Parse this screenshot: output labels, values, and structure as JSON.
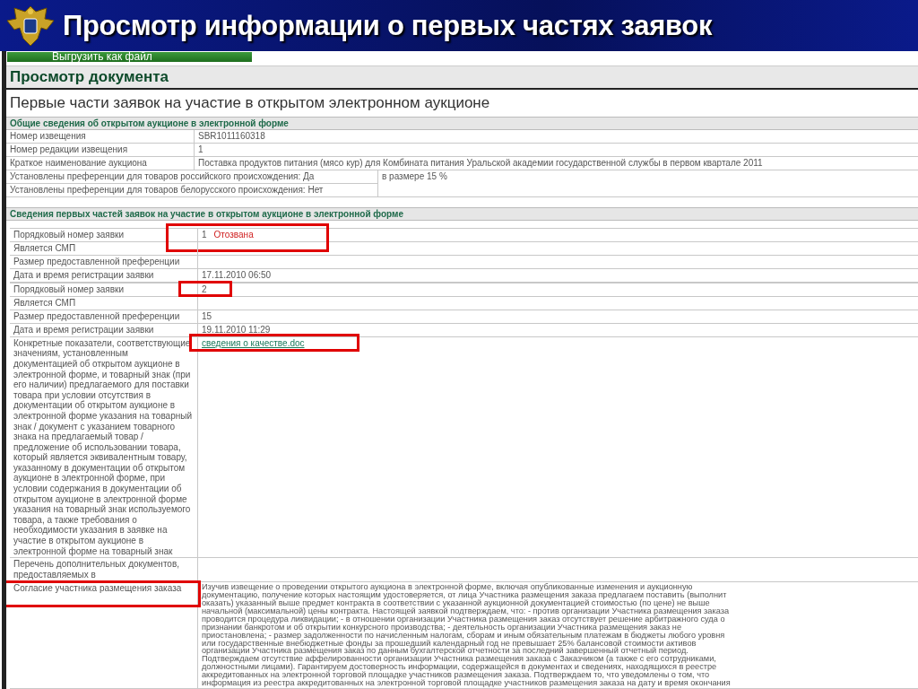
{
  "slide_title": "Просмотр информации о первых частях заявок",
  "export_button": "Выгрузить как файл",
  "page_heading": "Просмотр документа",
  "document_title": "Первые части заявок на участие в открытом электронном аукционе",
  "general_section": {
    "heading": "Общие сведения об открытом аукционе в электронной форме",
    "rows": [
      {
        "label": "Номер извещения",
        "value": "SBR1011160318"
      },
      {
        "label": "Номер редакции извещения",
        "value": "1"
      },
      {
        "label": "Краткое наименование аукциона",
        "value": "Поставка продуктов питания (мясо кур) для Комбината питания Уральской академии государственной службы в первом квартале 2011"
      }
    ],
    "preferences": [
      "Установлены преференции для товаров российского происхождения: Да",
      "Установлены преференции для товаров белорусского происхождения: Нет"
    ],
    "preference_value": "в размере 15 %"
  },
  "applications_section": {
    "heading": "Сведения первых частей заявок на участие в открытом аукционе в электронной форме",
    "rows": [
      {
        "label": "Порядковый номер заявки",
        "kind": "text",
        "value": "1",
        "status": "Отозвана",
        "highlighted": true,
        "group_start": true
      },
      {
        "label": "Является СМП",
        "kind": "text",
        "value": "",
        "highlighted": false,
        "group_start": false
      },
      {
        "label": "Размер предоставленной преференции",
        "kind": "text",
        "value": "",
        "highlighted": false,
        "group_start": false
      },
      {
        "label": "Дата и время регистрации заявки",
        "kind": "text",
        "value": "17.11.2010 06:50",
        "highlighted": false,
        "group_start": false
      },
      {
        "label": "Порядковый номер заявки",
        "kind": "text",
        "value": "2",
        "highlighted": true,
        "group_start": true
      },
      {
        "label": "Является СМП",
        "kind": "text",
        "value": "",
        "highlighted": false,
        "group_start": false
      },
      {
        "label": "Размер предоставленной преференции",
        "kind": "text",
        "value": "15",
        "highlighted": false,
        "group_start": false
      },
      {
        "label": "Дата и время регистрации заявки",
        "kind": "text",
        "value": "19.11.2010 11:29",
        "highlighted": false,
        "group_start": false
      },
      {
        "label": "Конкретные показатели, соответствующие значениям, установленным документацией об открытом аукционе в электронной форме, и товарный знак (при его наличии) предлагаемого для поставки товара при условии отсутствия в документации об открытом аукционе в электронной форме указания на товарный знак / документ с указанием товарного знака на предлагаемый товар / предложение об использовании товара, который является эквивалентным товару, указанному в документации об открытом аукционе в электронной форме, при условии содержания в документации об открытом аукционе в электронной форме указания на товарный знак используемого товара, а также требования о необходимости указания в заявке на участие в открытом аукционе в электронной форме на товарный знак",
        "kind": "link",
        "value": "сведения о качестве.doc",
        "highlighted": true,
        "group_start": false
      },
      {
        "label": "Перечень дополнительных документов, предоставляемых в",
        "kind": "text",
        "value": "",
        "highlighted": false,
        "group_start": false
      },
      {
        "label": "Согласие участника размещения заказа",
        "kind": "paragraph",
        "lines": [
          "Изучив извещение о проведении открытого аукциона в электронной форме, включая опубликованные изменения и аукционную",
          "документацию, получение которых настоящим удостоверяется, от лица Участника размещения заказа предлагаем поставить (выполнит",
          "оказать) указанный выше предмет контракта в соответствии с указанной аукционной документацией стоимостью (по цене) не выше",
          "начальной (максимальной) цены контракта. Настоящей заявкой подтверждаем, что: - против организации Участника размещения заказа",
          "проводится процедура ликвидации; - в отношении организации Участника размещения заказ отсутствует решение арбитражного суда о",
          "признании банкротом и об открытии конкурсного производства; - деятельность организации Участника размещения заказ не",
          "приостановлена; - размер задолженности по начисленным налогам, сборам и иным обязательным платежам в бюджеты любого уровня",
          "или государственные внебюджетные фонды за прошедший календарный год не превышает 25% балансовой стоимости активов",
          "организации Участника размещения заказ по данным бухгалтерской отчетности за последний завершенный отчетный период.",
          "Подтверждаем отсутствие аффелированности организации Участника размещения заказа с Заказчиком (а также с его сотрудниками,",
          "должностными лицами). Гарантируем достоверность информации, содержащейся в документах и сведениях, находящихся в реестре",
          "аккредитованных на электронной торговой площадке участников размещения заказа. Подтверждаем то, что уведомлены о том, что",
          "информация из реестра аккредитованных на электронной торговой площадке участников размещения заказа на дату и время окончания"
        ],
        "highlighted": true,
        "group_start": false
      }
    ]
  }
}
